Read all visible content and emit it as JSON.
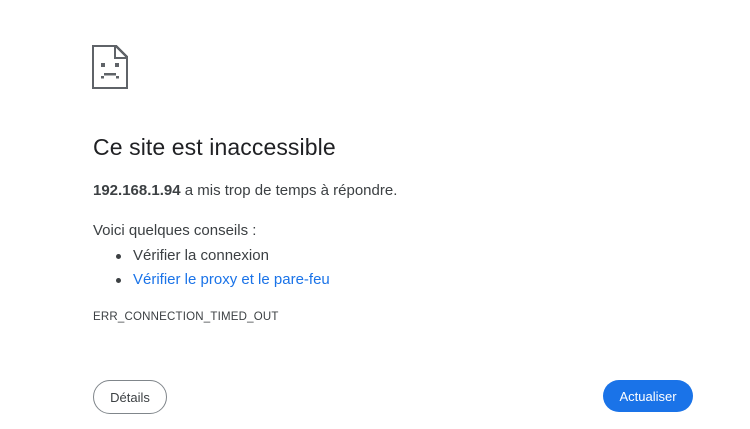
{
  "error": {
    "icon": "sad-page-icon",
    "title": "Ce site est inaccessible",
    "host": "192.168.1.94",
    "summary_rest": " a mis trop de temps à répondre.",
    "tips_heading": "Voici quelques conseils :",
    "tips": [
      {
        "label": "Vérifier la connexion",
        "is_link": false
      },
      {
        "label": "Vérifier le proxy et le pare-feu",
        "is_link": true
      }
    ],
    "code": "ERR_CONNECTION_TIMED_OUT"
  },
  "buttons": {
    "details_label": "Détails",
    "reload_label": "Actualiser"
  },
  "colors": {
    "link": "#1a73e8",
    "primary_button": "#1a73e8",
    "text": "#3c4043",
    "title": "#202124"
  }
}
